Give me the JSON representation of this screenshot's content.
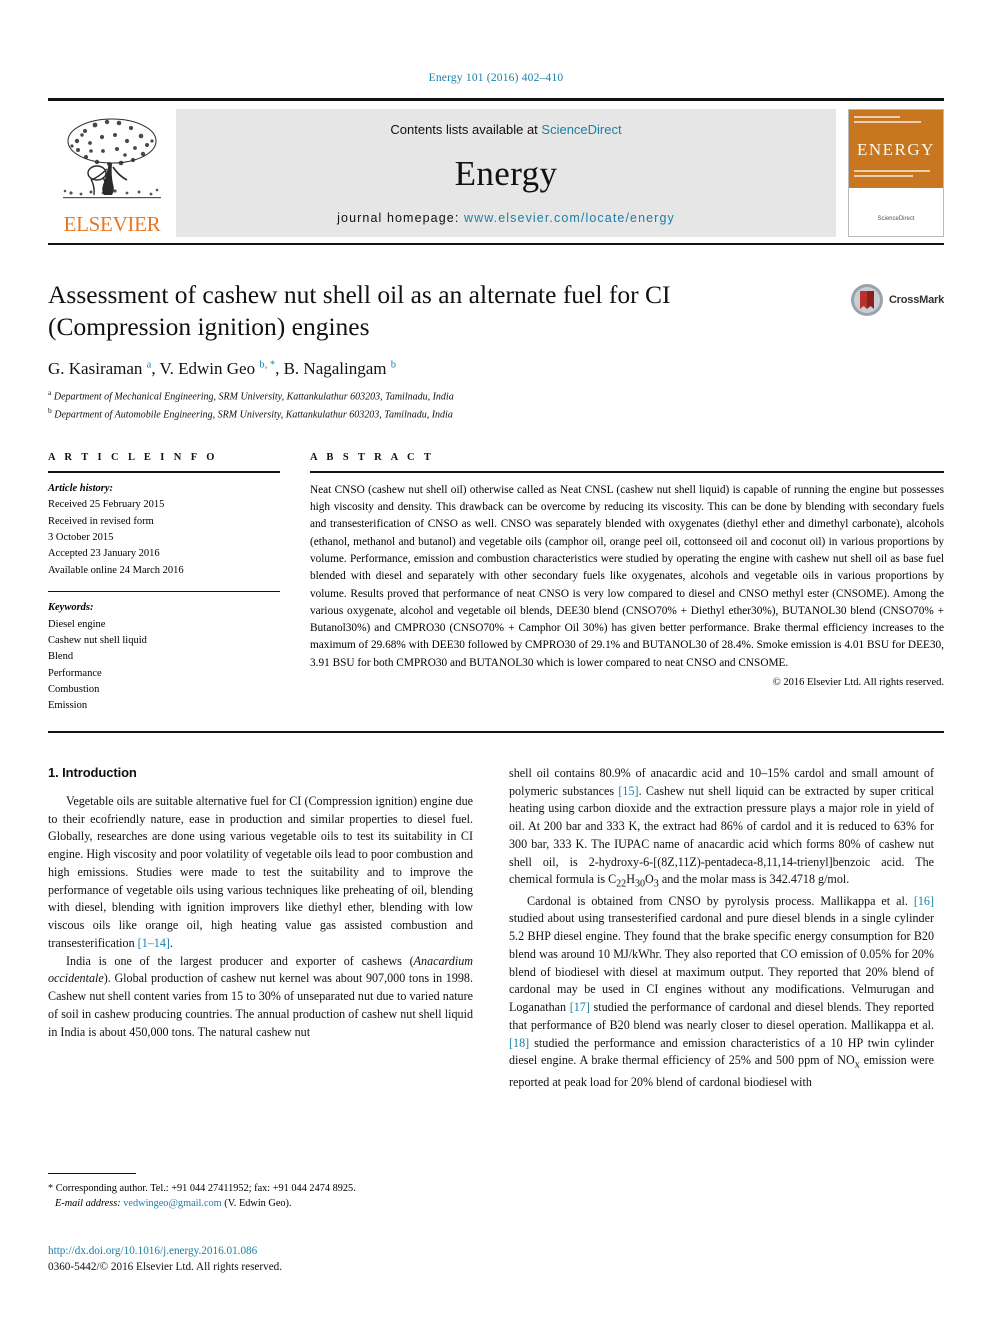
{
  "running_head": "Energy 101 (2016) 402–410",
  "masthead": {
    "contents_prefix": "Contents lists available at ",
    "contents_link": "ScienceDirect",
    "journal_name": "Energy",
    "homepage_prefix": "journal homepage: ",
    "homepage_url": "www.elsevier.com/locate/energy",
    "publisher_logo_text": "ELSEVIER",
    "cover_title": "ENERGY",
    "cover_footer": "ScienceDirect"
  },
  "article": {
    "title": "Assessment of cashew nut shell oil as an alternate fuel for CI (Compression ignition) engines",
    "authors_html": "G. Kasiraman <sup>a</sup>, V. Edwin Geo <sup>b, *</sup>, B. Nagalingam <sup>b</sup>",
    "affiliation_a": "Department of Mechanical Engineering, SRM University, Kattankulathur 603203, Tamilnadu, India",
    "affiliation_b": "Department of Automobile Engineering, SRM University, Kattankulathur 603203, Tamilnadu, India",
    "crossmark_label": "CrossMark"
  },
  "article_info": {
    "heading": "A R T I C L E  I N F O",
    "history_heading": "Article history:",
    "history": [
      "Received 25 February 2015",
      "Received in revised form",
      "3 October 2015",
      "Accepted 23 January 2016",
      "Available online 24 March 2016"
    ],
    "keywords_heading": "Keywords:",
    "keywords": [
      "Diesel engine",
      "Cashew nut shell liquid",
      "Blend",
      "Performance",
      "Combustion",
      "Emission"
    ]
  },
  "abstract": {
    "heading": "A B S T R A C T",
    "text": "Neat CNSO (cashew nut shell oil) otherwise called as Neat CNSL (cashew nut shell liquid) is capable of running the engine but possesses high viscosity and density. This drawback can be overcome by reducing its viscosity. This can be done by blending with secondary fuels and transesterification of CNSO as well. CNSO was separately blended with oxygenates (diethyl ether and dimethyl carbonate), alcohols (ethanol, methanol and butanol) and vegetable oils (camphor oil, orange peel oil, cottonseed oil and coconut oil) in various proportions by volume. Performance, emission and combustion characteristics were studied by operating the engine with cashew nut shell oil as base fuel blended with diesel and separately with other secondary fuels like oxygenates, alcohols and vegetable oils in various proportions by volume. Results proved that performance of neat CNSO is very low compared to diesel and CNSO methyl ester (CNSOME). Among the various oxygenate, alcohol and vegetable oil blends, DEE30 blend (CNSO70% + Diethyl ether30%), BUTANOL30 blend (CNSO70% + Butanol30%) and CMPRO30 (CNSO70% + Camphor Oil 30%) has given better performance. Brake thermal efficiency increases to the maximum of 29.68% with DEE30 followed by CMPRO30 of 29.1% and BUTANOL30 of 28.4%. Smoke emission is 4.01 BSU for DEE30, 3.91 BSU for both CMPRO30 and BUTANOL30 which is lower compared to neat CNSO and CNSOME.",
    "copyright": "© 2016 Elsevier Ltd. All rights reserved."
  },
  "body": {
    "section_number_title": "1. Introduction",
    "left_paragraphs": [
      "Vegetable oils are suitable alternative fuel for CI (Compression ignition) engine due to their ecofriendly nature, ease in production and similar properties to diesel fuel. Globally, researches are done using various vegetable oils to test its suitability in CI engine. High viscosity and poor volatility of vegetable oils lead to poor combustion and high emissions. Studies were made to test the suitability and to improve the performance of vegetable oils using various techniques like preheating of oil, blending with diesel, blending with ignition improvers like diethyl ether, blending with low viscous oils like orange oil, high heating value gas assisted combustion and transesterification [1–14].",
      "India is one of the largest producer and exporter of cashews (Anacardium occidentale). Global production of cashew nut kernel was about 907,000 tons in 1998. Cashew nut shell content varies from 15 to 30% of unseparated nut due to varied nature of soil in cashew producing countries. The annual production of cashew nut shell liquid in India is about 450,000 tons. The natural cashew nut"
    ],
    "right_paragraphs": [
      "shell oil contains 80.9% of anacardic acid and 10–15% cardol and small amount of polymeric substances [15]. Cashew nut shell liquid can be extracted by super critical heating using carbon dioxide and the extraction pressure plays a major role in yield of oil. At 200 bar and 333 K, the extract had 86% of cardol and it is reduced to 63% for 300 bar, 333 K. The IUPAC name of anacardic acid which forms 80% of cashew nut shell oil, is 2-hydroxy-6-[(8Z,11Z)-pentadeca-8,11,14-trienyl]benzoic acid. The chemical formula is C22H30O3 and the molar mass is 342.4718 g/mol.",
      "Cardonal is obtained from CNSO by pyrolysis process. Mallikappa et al. [16] studied about using transesterified cardonal and pure diesel blends in a single cylinder 5.2 BHP diesel engine. They found that the brake specific energy consumption for B20 blend was around 10 MJ/kWhr. They also reported that CO emission of 0.05% for 20% blend of biodiesel with diesel at maximum output. They reported that 20% blend of cardonal may be used in CI engines without any modifications. Velmurugan and Loganathan [17] studied the performance of cardonal and diesel blends. They reported that performance of B20 blend was nearly closer to diesel operation. Mallikappa et al. [18] studied the performance and emission characteristics of a 10 HP twin cylinder diesel engine. A brake thermal efficiency of 25% and 500 ppm of NOx emission were reported at peak load for 20% blend of cardonal biodiesel with"
    ]
  },
  "footnote": {
    "corresponding": "* Corresponding author. Tel.: +91 044 27411952; fax: +91 044 2474 8925.",
    "email_label": "E-mail address:",
    "email": "vedwingeo@gmail.com",
    "email_suffix": " (V. Edwin Geo)."
  },
  "footer": {
    "doi": "http://dx.doi.org/10.1016/j.energy.2016.01.086",
    "issn": "0360-5442/© 2016 Elsevier Ltd. All rights reserved."
  },
  "colors": {
    "link_blue": "#1b7fa8",
    "elsevier_orange": "#E87722",
    "masthead_gray": "#e6e6e6",
    "crossmark_red": "#B8312F"
  }
}
